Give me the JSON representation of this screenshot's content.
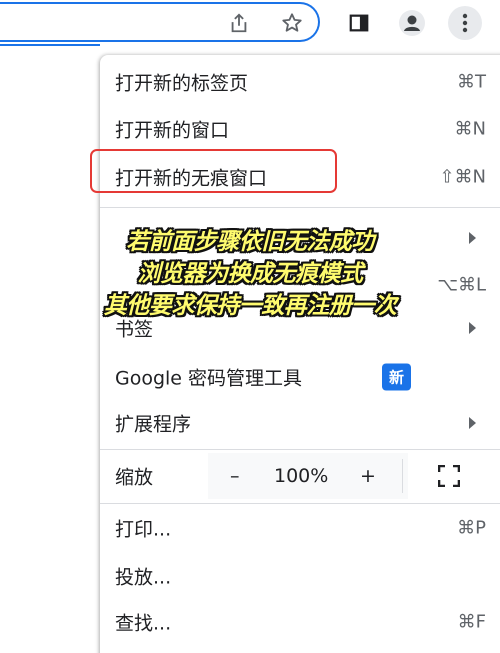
{
  "toolbar": {
    "icons": [
      "share-icon",
      "star-icon",
      "side-panel-icon",
      "profile-icon",
      "more-vert-icon"
    ]
  },
  "menu": {
    "new_tab": {
      "label": "打开新的标签页",
      "shortcut": "⌘T"
    },
    "new_window": {
      "label": "打开新的窗口",
      "shortcut": "⌘N"
    },
    "new_incognito": {
      "label": "打开新的无痕窗口",
      "shortcut": "⇧⌘N"
    },
    "history_shortcut": "⌥⌘L",
    "bookmarks": {
      "label": "书签"
    },
    "password_manager": {
      "label": "Google 密码管理工具",
      "badge": "新"
    },
    "extensions": {
      "label": "扩展程序"
    },
    "zoom": {
      "label": "缩放",
      "minus": "–",
      "value": "100%",
      "plus": "+"
    },
    "print": {
      "label": "打印...",
      "shortcut": "⌘P"
    },
    "cast": {
      "label": "投放..."
    },
    "find": {
      "label": "查找...",
      "shortcut": "⌘F"
    }
  },
  "overlay": {
    "line1": "若前面步骤依旧无法成功",
    "line2": "浏览器为换成无痕模式",
    "line3": "其他要求保持一致再注册一次"
  },
  "colors": {
    "accent": "#1a73e8",
    "highlight_border": "#e53935",
    "caption_fill": "#fffb6e"
  }
}
